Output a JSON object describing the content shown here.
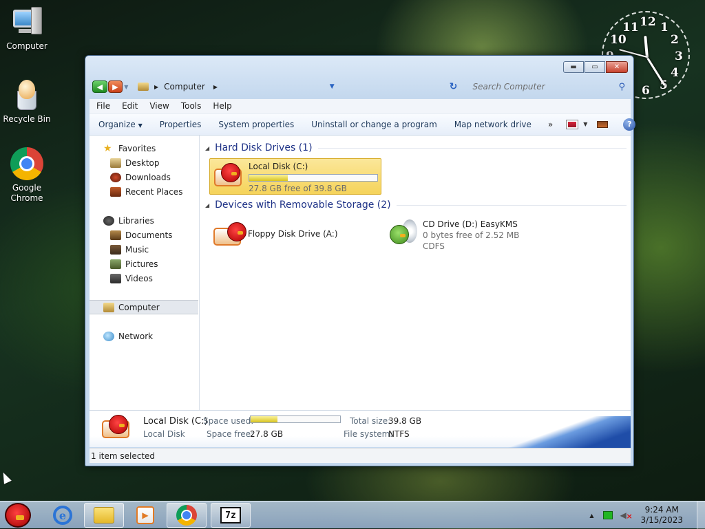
{
  "desktop": {
    "icons": [
      {
        "label": "Computer"
      },
      {
        "label": "Recycle Bin"
      },
      {
        "label": "Google Chrome"
      }
    ]
  },
  "clock": {
    "numerals": [
      "12",
      "1",
      "2",
      "3",
      "4",
      "5",
      "6",
      "11",
      "10",
      "9"
    ]
  },
  "window": {
    "address": {
      "crumb": "Computer"
    },
    "search": {
      "placeholder": "Search Computer"
    },
    "menubar": [
      "File",
      "Edit",
      "View",
      "Tools",
      "Help"
    ],
    "commands": {
      "organize": "Organize",
      "properties": "Properties",
      "system_properties": "System properties",
      "uninstall": "Uninstall or change a program",
      "map_drive": "Map network drive",
      "more": "»"
    },
    "nav": {
      "favorites": "Favorites",
      "desktop": "Desktop",
      "downloads": "Downloads",
      "recent": "Recent Places",
      "libraries": "Libraries",
      "documents": "Documents",
      "music": "Music",
      "pictures": "Pictures",
      "videos": "Videos",
      "computer": "Computer",
      "network": "Network"
    },
    "groups": {
      "hdd": "Hard Disk Drives (1)",
      "removable": "Devices with Removable Storage (2)"
    },
    "drives": {
      "c": {
        "name": "Local Disk (C:)",
        "free": "27.8 GB free of 39.8 GB",
        "used_fraction": 0.3
      },
      "a": {
        "name": "Floppy Disk Drive (A:)"
      },
      "d": {
        "name": "CD Drive (D:) EasyKMS",
        "free": "0 bytes free of 2.52 MB",
        "fs": "CDFS"
      }
    },
    "details": {
      "name": "Local Disk (C:)",
      "type": "Local Disk",
      "space_used_label": "Space used:",
      "space_free_label": "Space free:",
      "space_free": "27.8 GB",
      "total_label": "Total size:",
      "total": "39.8 GB",
      "fs_label": "File system:",
      "fs": "NTFS",
      "used_fraction": 0.3
    },
    "status": "1 item selected"
  },
  "taskbar": {
    "time": "9:24 AM",
    "date": "3/15/2023",
    "seven_zip": "7z"
  }
}
